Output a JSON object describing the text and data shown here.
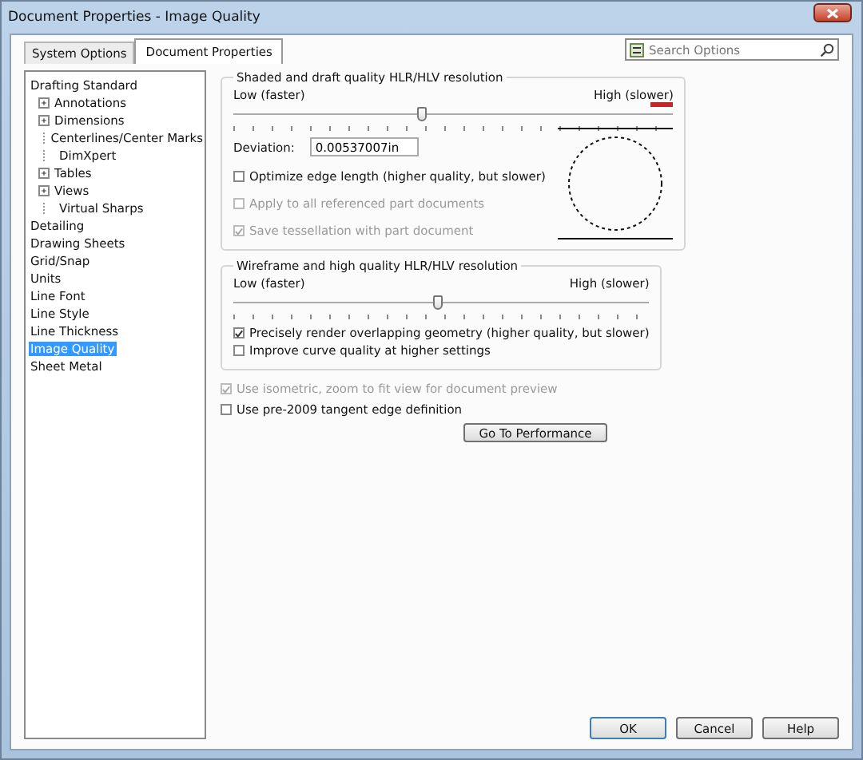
{
  "window": {
    "title": "Document Properties - Image Quality"
  },
  "tabs": [
    {
      "label": "System Options",
      "selected": false
    },
    {
      "label": "Document Properties",
      "selected": true
    }
  ],
  "search": {
    "placeholder": "Search Options"
  },
  "tree": [
    {
      "label": "Drafting Standard",
      "selected": false,
      "children": [
        {
          "label": "Annotations",
          "selected": false,
          "expanded": false
        },
        {
          "label": "Dimensions",
          "selected": false,
          "expanded": false
        },
        {
          "label": "Centerlines/Center Marks",
          "selected": false
        },
        {
          "label": "DimXpert",
          "selected": false
        },
        {
          "label": "Tables",
          "selected": false,
          "expanded": false
        },
        {
          "label": "Views",
          "selected": false,
          "expanded": false
        },
        {
          "label": "Virtual Sharps",
          "selected": false
        }
      ]
    },
    {
      "label": "Detailing",
      "selected": false
    },
    {
      "label": "Drawing Sheets",
      "selected": false
    },
    {
      "label": "Grid/Snap",
      "selected": false
    },
    {
      "label": "Units",
      "selected": false
    },
    {
      "label": "Line Font",
      "selected": false
    },
    {
      "label": "Line Style",
      "selected": false
    },
    {
      "label": "Line Thickness",
      "selected": false
    },
    {
      "label": "Image Quality",
      "selected": true
    },
    {
      "label": "Sheet Metal",
      "selected": false
    }
  ],
  "shaded_group": {
    "title": "Shaded and draft quality HLR/HLV resolution",
    "low_label": "Low (faster)",
    "high_label": "High (slower)",
    "slider": {
      "level": 0.43
    },
    "deviation_label": "Deviation:",
    "deviation_value": "0.00537007in",
    "options": [
      {
        "label": "Optimize edge length (higher quality, but slower)",
        "checked": false,
        "disabled": false
      },
      {
        "label": "Apply to all referenced part documents",
        "checked": false,
        "disabled": true
      },
      {
        "label": "Save tessellation with part document",
        "checked": true,
        "disabled": true
      }
    ]
  },
  "wireframe_group": {
    "title": "Wireframe and high quality HLR/HLV resolution",
    "low_label": "Low (faster)",
    "high_label": "High (slower)",
    "slider": {
      "level": 0.49
    },
    "options": [
      {
        "label": "Precisely render overlapping geometry (higher quality, but slower)",
        "checked": true,
        "disabled": false
      },
      {
        "label": "Improve curve quality at higher settings",
        "checked": false,
        "disabled": false
      }
    ]
  },
  "options": [
    {
      "label": "Use isometric, zoom to fit view for document preview",
      "checked": true,
      "disabled": true
    },
    {
      "label": "Use pre-2009 tangent edge definition",
      "checked": false,
      "disabled": false
    }
  ],
  "performance_button": "Go To Performance",
  "buttons": [
    "OK",
    "Cancel",
    "Help"
  ]
}
